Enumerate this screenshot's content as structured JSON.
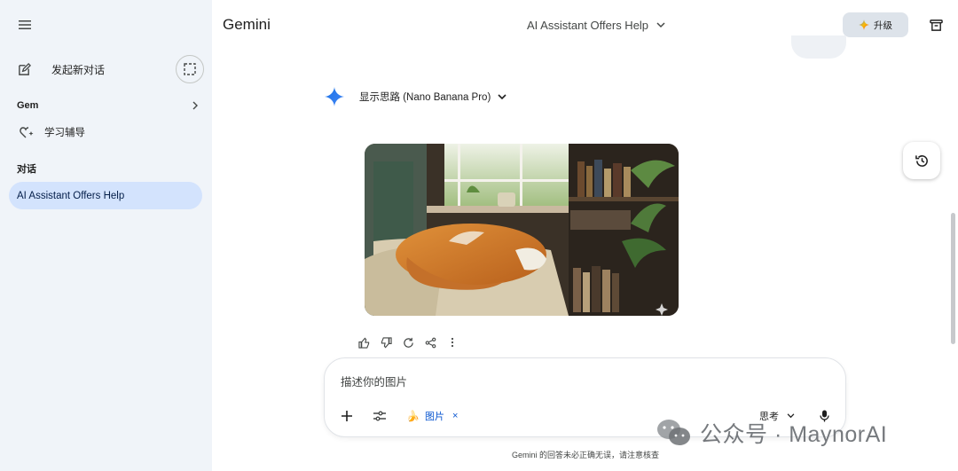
{
  "sidebar": {
    "new_chat_label": "发起新对话",
    "gem_section_label": "Gem",
    "gem_items": [
      {
        "label": "学习辅导"
      }
    ],
    "chats_section_label": "对话",
    "chats": [
      {
        "label": "AI Assistant Offers Help",
        "active": true
      }
    ]
  },
  "header": {
    "brand": "Gemini",
    "conversation_title": "AI Assistant Offers Help",
    "upgrade_label": "升级"
  },
  "response": {
    "thoughts_label": "显示思路 (Nano Banana Pro)",
    "image": {
      "subject": "orange and white cat sleeping on a cream armchair by a sunny window with bookshelves and plants"
    },
    "actions": [
      "thumbs-up-icon",
      "thumbs-down-icon",
      "regenerate-icon",
      "share-icon",
      "more-vert-icon"
    ]
  },
  "composer": {
    "placeholder": "描述你的图片",
    "chip_emoji": "🍌",
    "chip_label": "图片",
    "chip_remove": "×",
    "mode_label": "思考"
  },
  "footer": {
    "disclaimer": "Gemini 的回答未必正确无误，请注意核查"
  },
  "watermark": {
    "text": "公众号 · MaynorAI"
  },
  "colors": {
    "sidebar_bg": "#f0f4f9",
    "active_chat_bg": "#d3e3fd",
    "accent_blue": "#0b57d0",
    "upgrade_bg": "#dde3ea"
  }
}
